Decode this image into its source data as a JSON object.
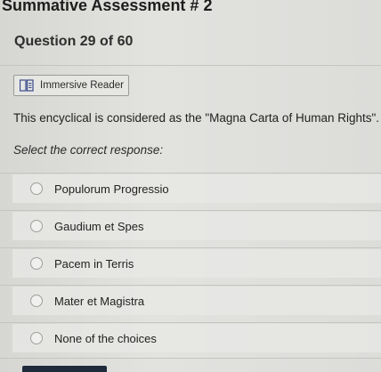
{
  "header": {
    "title": "Summative Assessment # 2"
  },
  "question_meta": {
    "label": "Question 29 of 60"
  },
  "toolbar": {
    "immersive_reader_label": "Immersive Reader",
    "immersive_reader_icon": "immersive-reader-icon"
  },
  "question": {
    "text": "This encyclical is considered as the \"Magna Carta of Human Rights\".",
    "instruction": "Select the correct response:"
  },
  "choices": [
    {
      "label": "Populorum Progressio",
      "selected": false
    },
    {
      "label": "Gaudium et Spes",
      "selected": false
    },
    {
      "label": "Pacem in Terris",
      "selected": false
    },
    {
      "label": "Mater et Magistra",
      "selected": false
    },
    {
      "label": "None of the choices",
      "selected": false
    }
  ],
  "colors": {
    "accent_bar": "#1f2a3a",
    "background": "#dcdcd9"
  }
}
